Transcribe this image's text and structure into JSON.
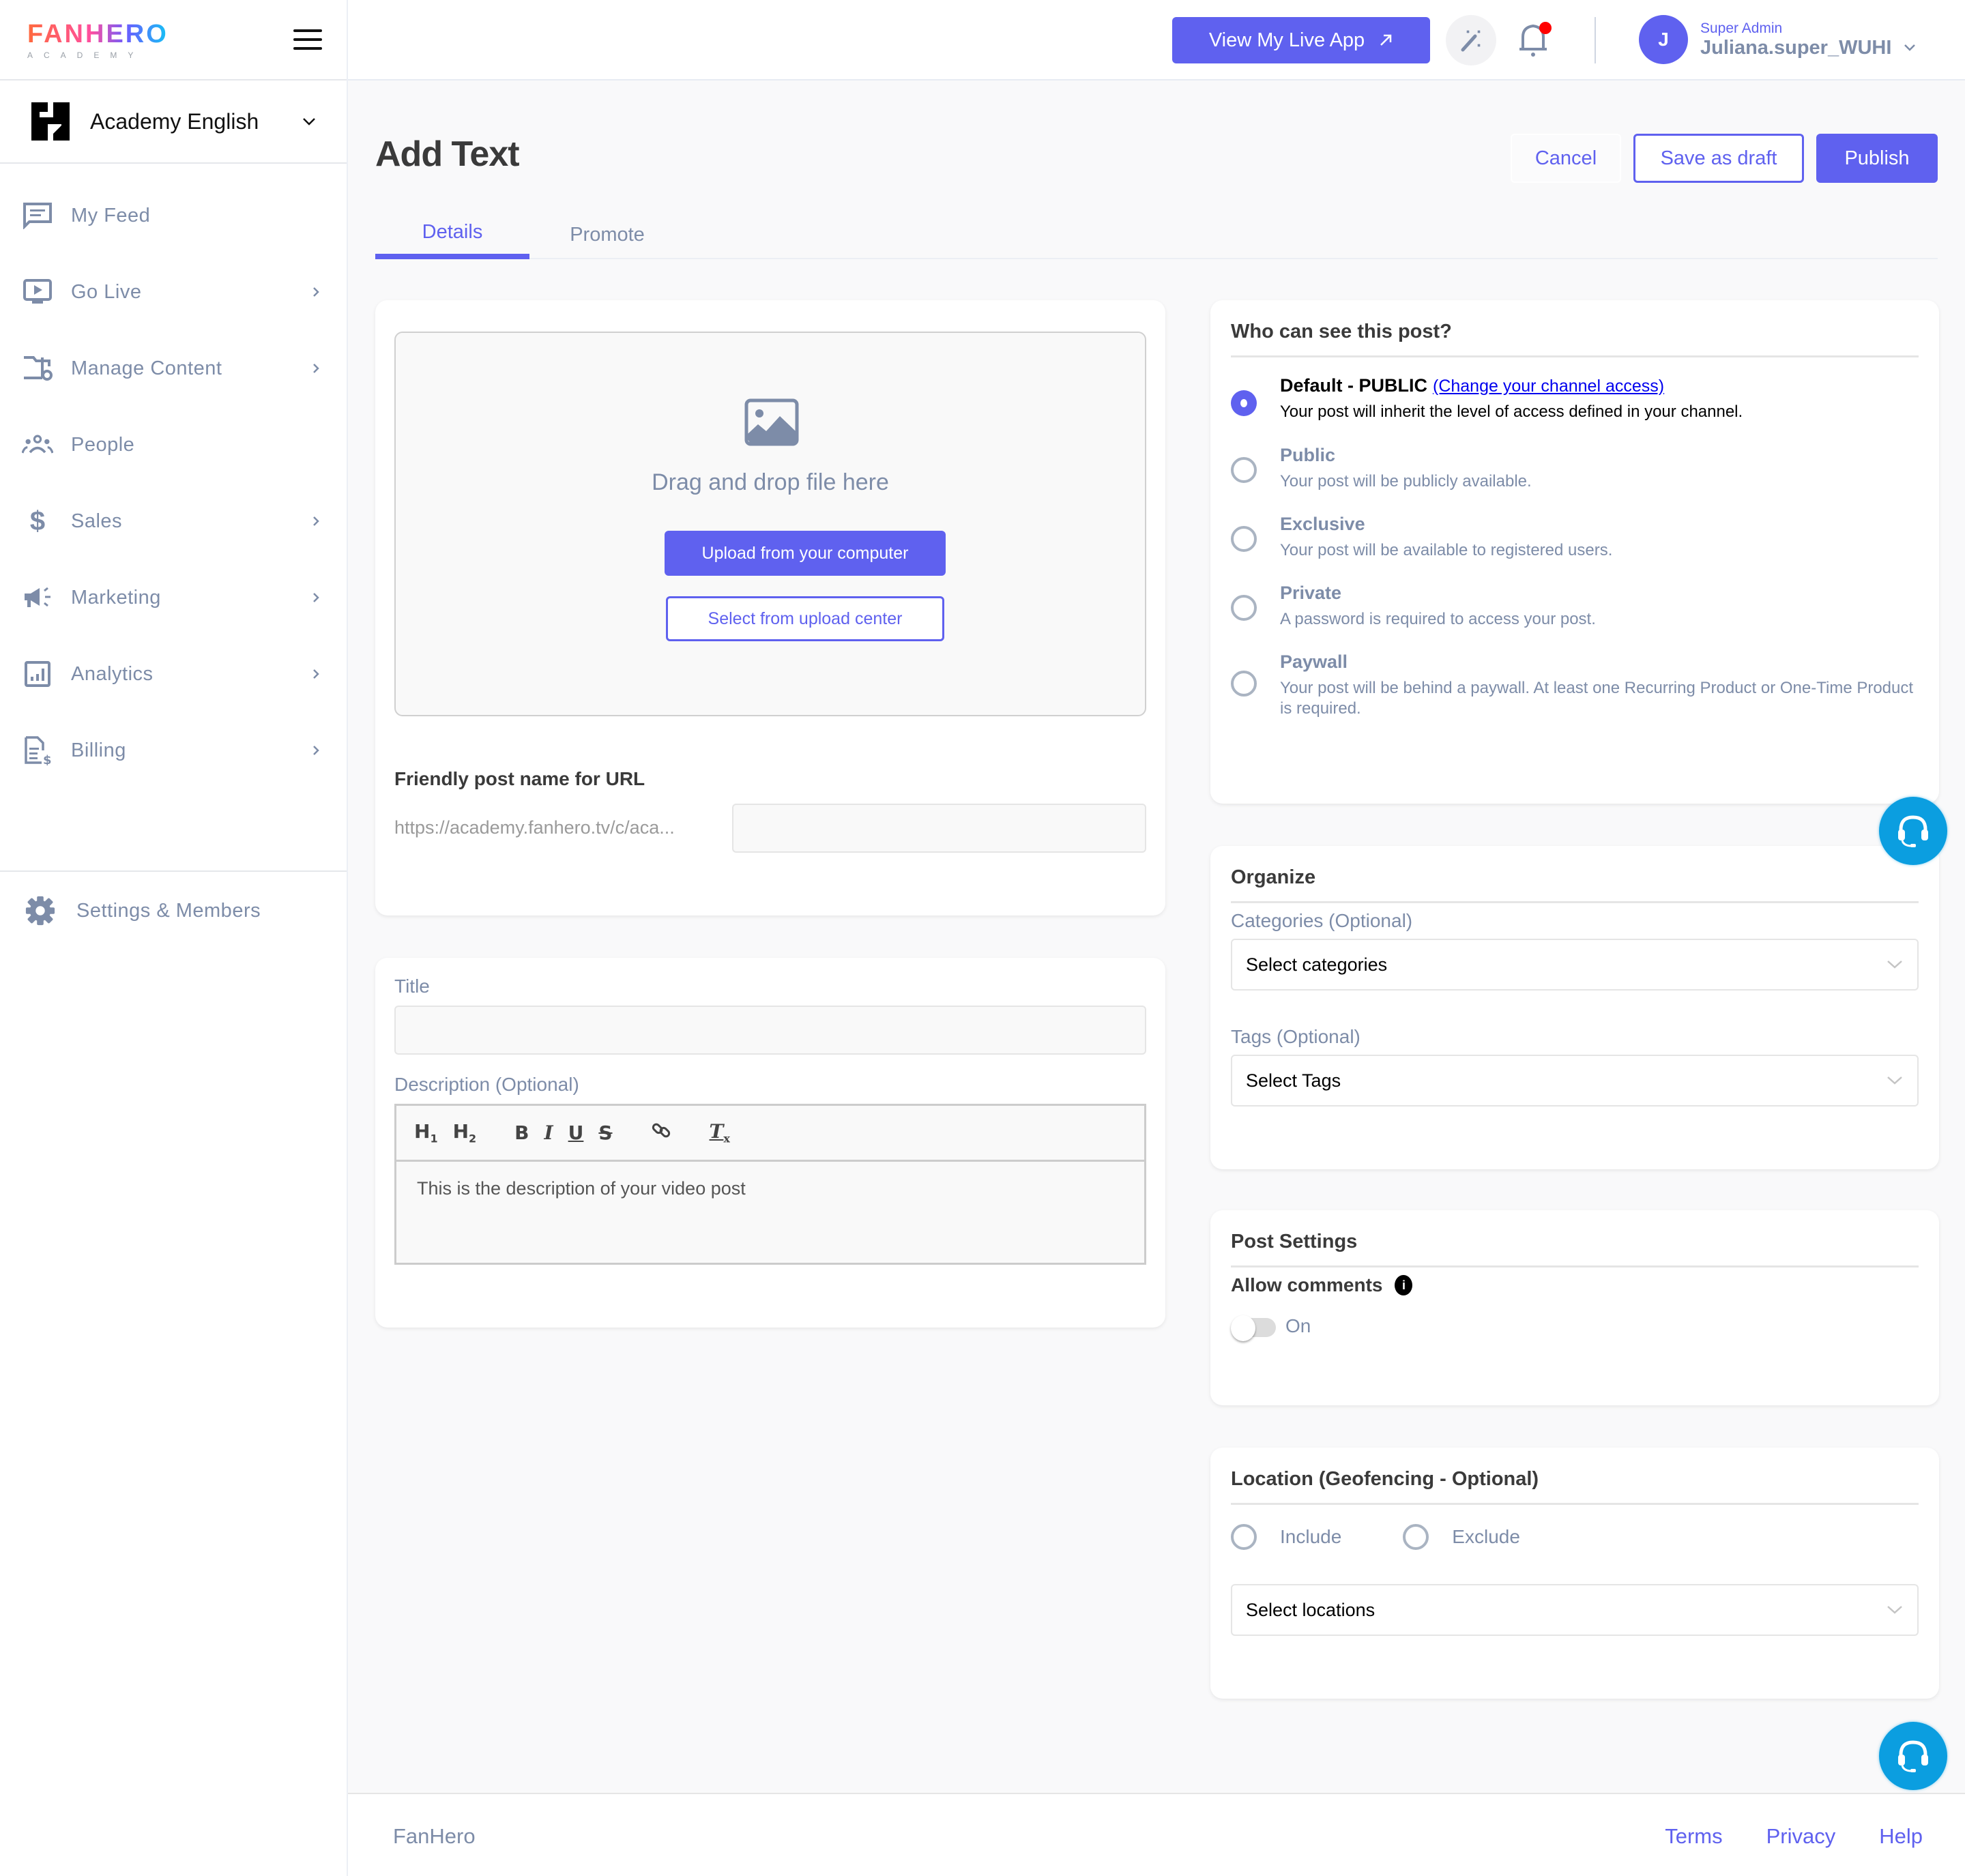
{
  "brand": {
    "logo_text": "FANHERO",
    "logo_subtext": "ACADEMY",
    "gradient_colors": [
      "#ff6a3d",
      "#ff4fa0",
      "#6a5cff",
      "#13c4f5"
    ]
  },
  "colors": {
    "accent": "#5f61ef",
    "muted_text": "#7d8ca8",
    "support_button": "#0b9ee0",
    "notification_dot": "#ff0000"
  },
  "channel": {
    "name": "Academy English"
  },
  "sidebar": {
    "items": [
      {
        "label": "My Feed",
        "icon": "feed-icon",
        "has_submenu": false
      },
      {
        "label": "Go Live",
        "icon": "live-tv-icon",
        "has_submenu": true
      },
      {
        "label": "Manage Content",
        "icon": "folder-settings-icon",
        "has_submenu": true
      },
      {
        "label": "People",
        "icon": "people-icon",
        "has_submenu": false
      },
      {
        "label": "Sales",
        "icon": "dollar-icon",
        "has_submenu": true
      },
      {
        "label": "Marketing",
        "icon": "megaphone-icon",
        "has_submenu": true
      },
      {
        "label": "Analytics",
        "icon": "analytics-icon",
        "has_submenu": true
      },
      {
        "label": "Billing",
        "icon": "billing-icon",
        "has_submenu": true
      }
    ],
    "settings_label": "Settings & Members"
  },
  "header": {
    "live_app_button": "View My Live App",
    "user_role": "Super Admin",
    "user_name": "Juliana.super_WUHI",
    "avatar_initial": "J"
  },
  "page": {
    "title": "Add Text",
    "actions": {
      "cancel": "Cancel",
      "save_draft": "Save as draft",
      "publish": "Publish"
    },
    "tabs": [
      {
        "label": "Details",
        "active": true
      },
      {
        "label": "Promote",
        "active": false
      }
    ]
  },
  "upload": {
    "drop_text": "Drag and drop file here",
    "upload_button": "Upload from your computer",
    "select_button": "Select from upload center",
    "url_label": "Friendly post name for URL",
    "url_prefix": "https://academy.fanhero.tv/c/aca...",
    "url_value": ""
  },
  "details": {
    "title_label": "Title",
    "title_value": "",
    "description_label": "Description (Optional)",
    "toolbar": [
      "H1",
      "H2",
      "Bold",
      "Italic",
      "Underline",
      "Strikethrough",
      "Link",
      "Clear formatting"
    ],
    "description_placeholder": "This is the description of your video post"
  },
  "visibility": {
    "heading": "Who can see this post?",
    "default": {
      "title": "Default - PUBLIC",
      "link": "(Change your channel access)",
      "description": "Your post will inherit the level of access defined in your channel.",
      "selected": true
    },
    "options": [
      {
        "title": "Public",
        "description": "Your post will be publicly available.",
        "selected": false
      },
      {
        "title": "Exclusive",
        "description": "Your post will be available to registered users.",
        "selected": false
      },
      {
        "title": "Private",
        "description": "A password is required to access your post.",
        "selected": false
      },
      {
        "title": "Paywall",
        "description": "Your post will be behind a paywall. At least one Recurring Product or One-Time Product is required.",
        "selected": false
      }
    ]
  },
  "organize": {
    "heading": "Organize",
    "categories_label": "Categories (Optional)",
    "categories_placeholder": "Select categories",
    "tags_label": "Tags (Optional)",
    "tags_placeholder": "Select Tags"
  },
  "post_settings": {
    "heading": "Post Settings",
    "allow_comments_label": "Allow comments",
    "toggle_label": "On",
    "toggle_on": false
  },
  "location": {
    "heading": "Location (Geofencing - Optional)",
    "include_label": "Include",
    "exclude_label": "Exclude",
    "select_placeholder": "Select locations"
  },
  "footer": {
    "brand": "FanHero",
    "links": [
      "Terms",
      "Privacy",
      "Help"
    ]
  }
}
